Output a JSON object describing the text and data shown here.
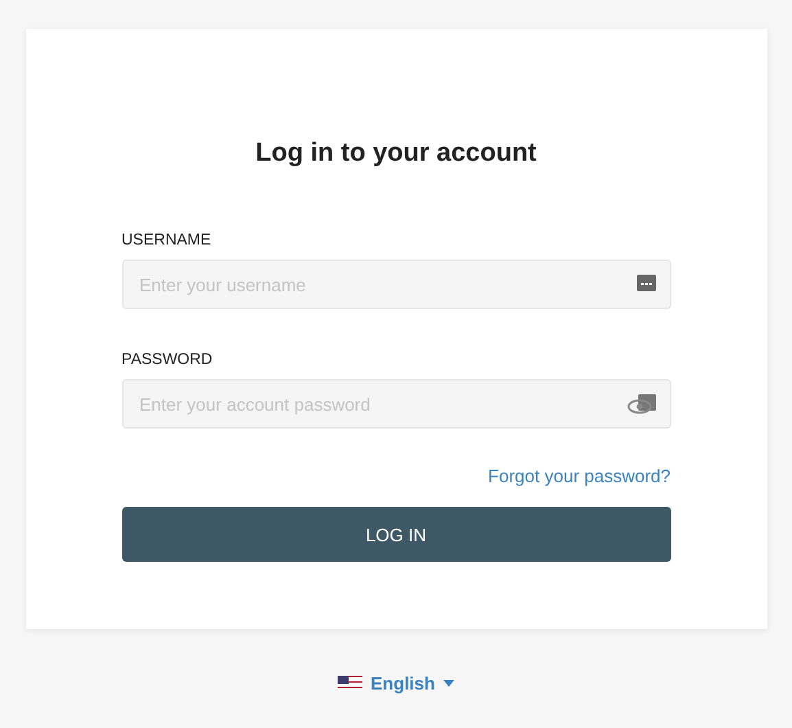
{
  "title": "Log in to your account",
  "fields": [
    {
      "label": "USERNAME",
      "placeholder": "Enter your username",
      "kind": "text"
    },
    {
      "label": "PASSWORD",
      "placeholder": "Enter your account password",
      "kind": "password"
    }
  ],
  "forgot_link": "Forgot your password?",
  "login_button": "LOG IN",
  "language": "English"
}
